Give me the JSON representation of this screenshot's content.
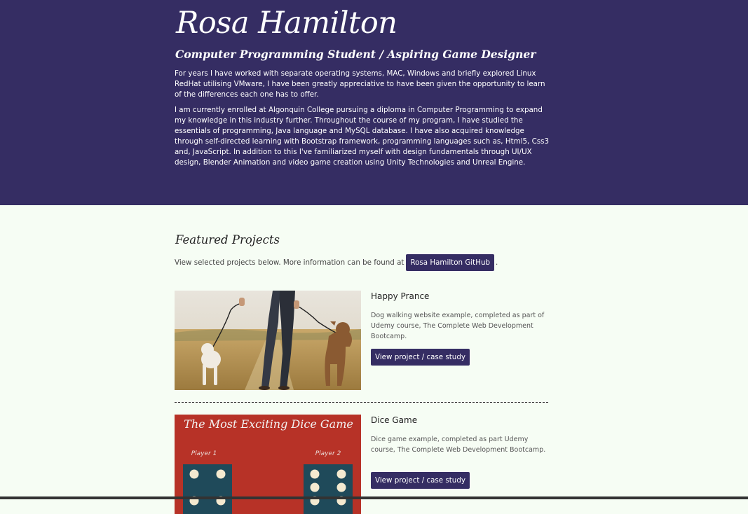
{
  "hero": {
    "name": "Rosa Hamilton",
    "tagline": "Computer Programming Student / Aspiring Game Designer",
    "bio": [
      "For years I have worked with separate operating systems, MAC, Windows and briefly explored Linux RedHat utilising VMware, I have been greatly appreciative to have been given the opportunity to learn of the differences each one has to offer.",
      "I am currently enrolled at Algonquin College pursuing a diploma in Computer Programming to expand my knowledge in this industry further. Throughout the course of my program, I have studied the essentials of programming, Java language and MySQL database. I have also acquired knowledge through self-directed learning with Bootstrap framework, programming languages such as, Html5, Css3 and, JavaScript. In addition to this I've familiarized myself with design fundamentals through UI/UX design, Blender Animation and video game creation using Unity Technologies and Unreal Engine."
    ]
  },
  "featured": {
    "title": "Featured Projects",
    "intro": "View selected projects below. More information can be found at",
    "github_label": "Rosa Hamilton GitHub",
    "trail": "."
  },
  "projects": [
    {
      "title": "Happy Prance",
      "description": "Dog walking website example, completed as part of Udemy course, The Complete Web Development Bootcamp.",
      "button": "View project / case study"
    },
    {
      "title": "Dice Game",
      "description": "Dice game example, completed as part Udemy course, The Complete Web Development Bootcamp.",
      "button": "View project / case study",
      "thumb_heading": "The Most Exciting Dice Game",
      "player1": "Player 1",
      "player2": "Player 2"
    }
  ],
  "colors": {
    "hero_bg": "#352d63",
    "page_bg": "#f6fdf4",
    "button_bg": "#352d63",
    "dice_bg": "#b73227",
    "dice_face": "#1f4a5a"
  }
}
